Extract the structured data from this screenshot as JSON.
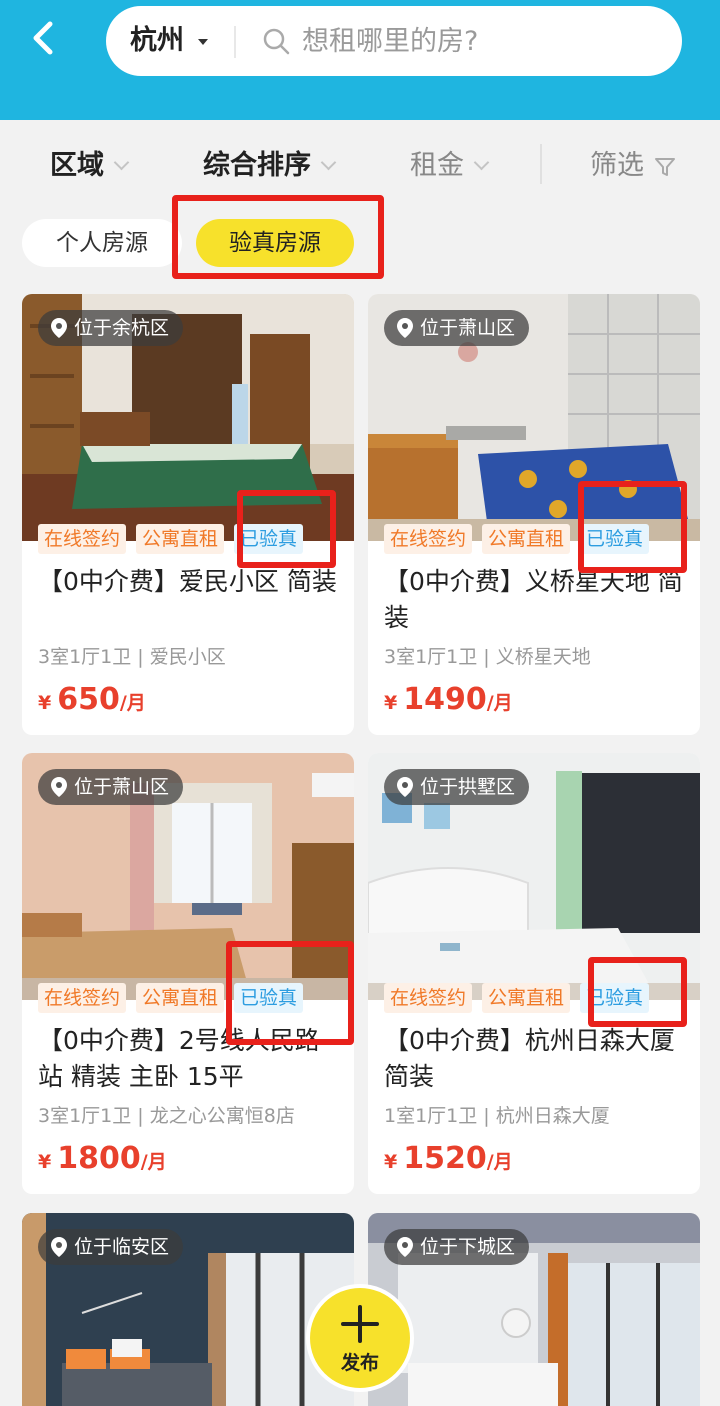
{
  "header": {
    "city": "杭州",
    "search_placeholder": "想租哪里的房?"
  },
  "filters": {
    "area": "区域",
    "sort": "综合排序",
    "rent": "租金",
    "filter": "筛选"
  },
  "source_tabs": {
    "personal": "个人房源",
    "verified": "验真房源",
    "active": "验真房源"
  },
  "listings": [
    {
      "location": "位于余杭区",
      "tags": [
        "在线签约",
        "公寓直租",
        "已验真"
      ],
      "title": "【0中介费】爱民小区 简装",
      "meta": "3室1厅1卫 | 爱民小区",
      "currency": "¥",
      "price": "650",
      "unit": "/月"
    },
    {
      "location": "位于萧山区",
      "tags": [
        "在线签约",
        "公寓直租",
        "已验真"
      ],
      "title": "【0中介费】义桥星天地 简装",
      "meta": "3室1厅1卫 | 义桥星天地",
      "currency": "¥",
      "price": "1490",
      "unit": "/月"
    },
    {
      "location": "位于萧山区",
      "tags": [
        "在线签约",
        "公寓直租",
        "已验真"
      ],
      "title": "【0中介费】2号线人民路站 精装 主卧 15平",
      "meta": "3室1厅1卫 | 龙之心公寓恒8店",
      "currency": "¥",
      "price": "1800",
      "unit": "/月"
    },
    {
      "location": "位于拱墅区",
      "tags": [
        "在线签约",
        "公寓直租",
        "已验真"
      ],
      "title": "【0中介费】杭州日森大厦 简装",
      "meta": "1室1厅1卫 | 杭州日森大厦",
      "currency": "¥",
      "price": "1520",
      "unit": "/月"
    },
    {
      "location": "位于临安区"
    },
    {
      "location": "位于下城区"
    }
  ],
  "fab": {
    "label": "发布"
  }
}
